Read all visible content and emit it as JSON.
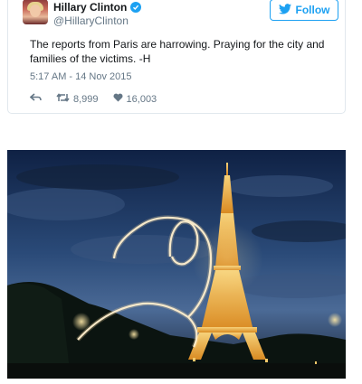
{
  "tweet": {
    "display_name": "Hillary Clinton",
    "handle": "@HillaryClinton",
    "follow_label": "Follow",
    "text": "The reports from Paris are harrowing. Praying for the city and families of the victims. -H",
    "timestamp": "5:17 AM - 14 Nov 2015",
    "retweets": "8,999",
    "likes": "16,003"
  },
  "colors": {
    "twitter_blue": "#1da1f2",
    "muted_gray": "#657786"
  },
  "icons": {
    "reply": "reply-icon",
    "retweet": "retweet-icon",
    "like": "heart-icon",
    "bird": "twitter-bird-icon",
    "verified": "verified-badge-icon"
  }
}
